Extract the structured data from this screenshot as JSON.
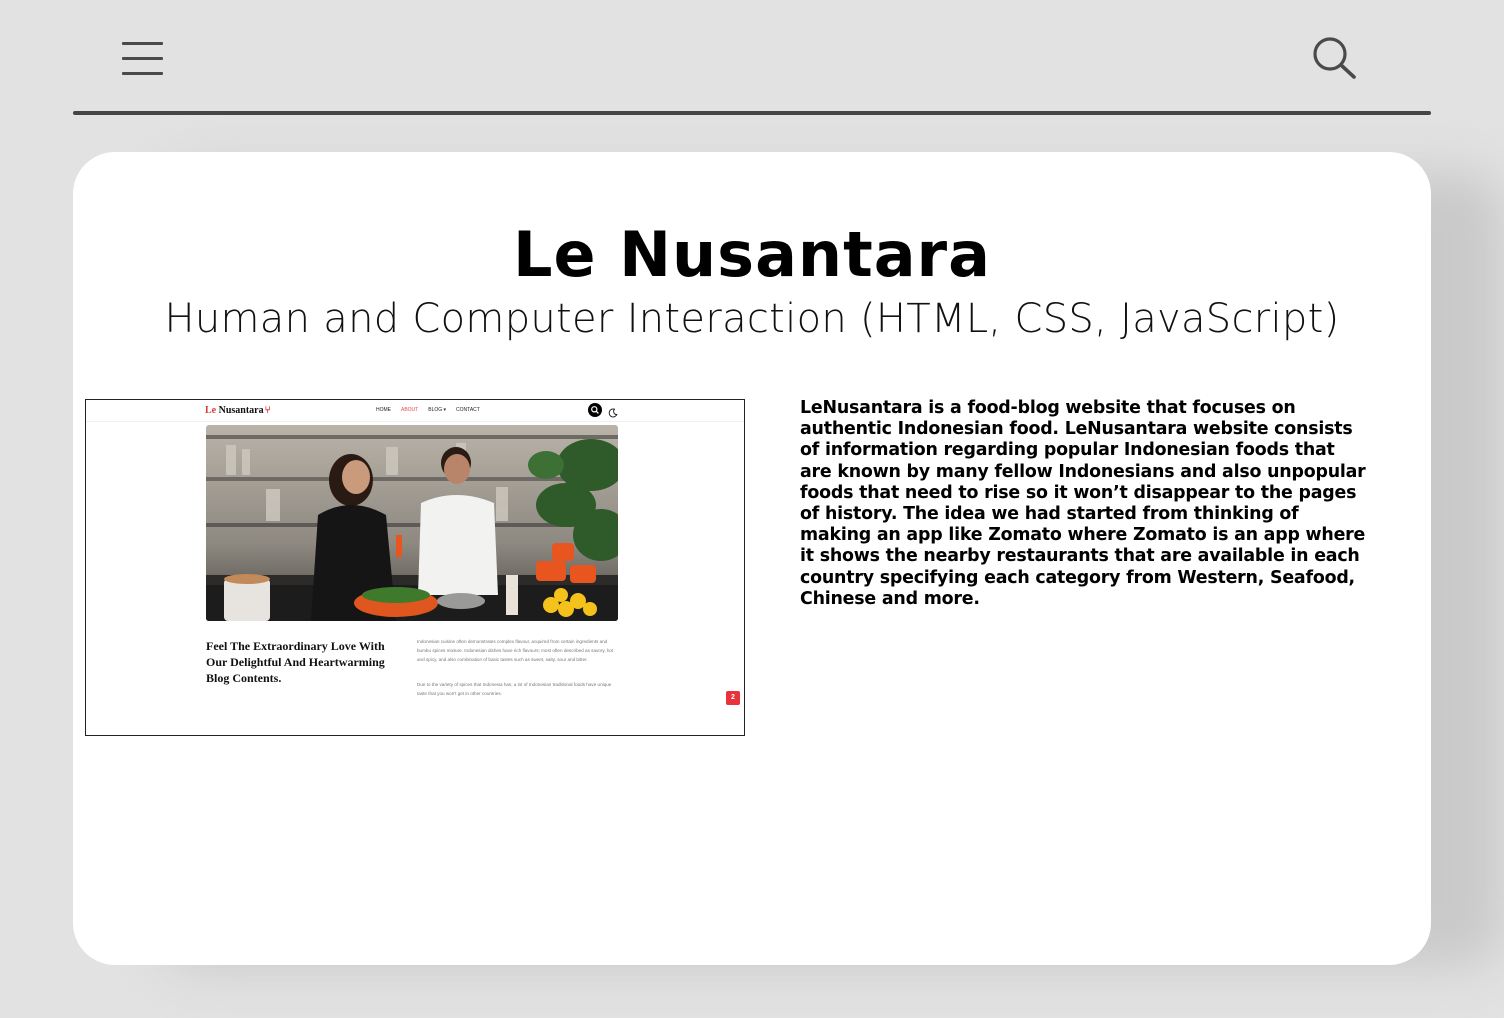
{
  "header": {
    "menu_icon": "hamburger-menu-icon",
    "search_icon": "magnifier-search-icon"
  },
  "card": {
    "title": "Le Nusantara",
    "subtitle": "Human and Computer Interaction (HTML, CSS, JavaScript)",
    "description": "LeNusantara is a food-blog website that focuses on authentic Indonesian food. LeNusantara website consists of information regarding popular Indonesian foods that are known by many fellow Indonesians and also unpopular foods that need to rise so it won’t disappear to the pages of history. The idea we had started from thinking of making an app like Zomato where Zomato is an app where it shows the nearby restaurants that are available in each country specifying each category from Western, Seafood, Chinese and more."
  },
  "preview": {
    "logo_le": "Le",
    "logo_rest": " Nusantara",
    "logo_icon": "fork-knife-icon",
    "nav": {
      "home": "HOME",
      "about": "ABOUT",
      "blog": "BLOG ▾",
      "contact": "CONTACT"
    },
    "accent_color": "#e54b4b",
    "heading": "Feel The Extraordinary Love With Our Delightful And Heartwarming Blog Contents.",
    "body1": "Indonesian cuisine often demonstrates complex flavour, acquired from certain ingredients and bumbu spices mixture. Indonesian dishes have rich flavours; most often described as savory, hot and spicy, and also combination of basic tastes such as sweet, salty, sour and bitter.",
    "body2": "Due to the variety of spices that Indonesia has, a lot of Indonesian traditional foods have unique taste that you won't get in other countries.",
    "badge": "2"
  }
}
